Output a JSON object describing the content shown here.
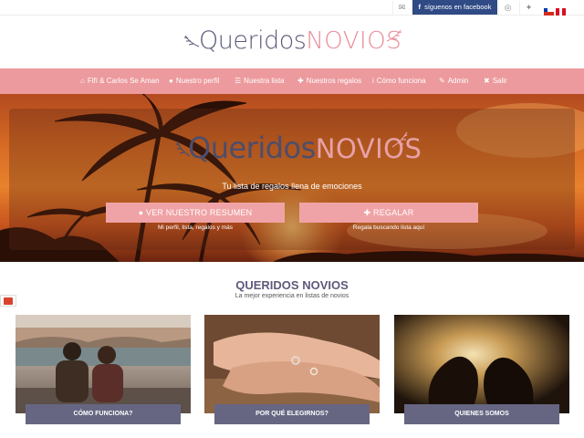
{
  "topbar": {
    "mail_icon": "envelope-icon",
    "facebook_label": "síguenos en facebook",
    "instagram_icon": "instagram-icon",
    "twitter_icon": "twitter-icon",
    "flags": [
      "chile-flag",
      "peru-flag"
    ]
  },
  "header": {
    "logo_part1": "Queridos",
    "logo_part2": "NOVIOS"
  },
  "nav": {
    "items": [
      {
        "icon": "home-icon",
        "glyph": "⌂",
        "label": "Fifí & Carlos Se Aman"
      },
      {
        "icon": "user-icon",
        "glyph": "●",
        "label": "Nuestro perfil"
      },
      {
        "icon": "list-icon",
        "glyph": "☰",
        "label": "Nuestra lista"
      },
      {
        "icon": "gift-icon",
        "glyph": "✚",
        "label": "Nuestros regalos"
      },
      {
        "icon": "info-icon",
        "glyph": "i",
        "label": "Cómo funciona"
      },
      {
        "icon": "wrench-icon",
        "glyph": "✎",
        "label": "Admin"
      },
      {
        "icon": "close-icon",
        "glyph": "✖",
        "label": "Salir"
      }
    ]
  },
  "hero": {
    "logo_part1": "Queridos",
    "logo_part2": "NOVIOS",
    "tagline": "Tu lista de regalos llena de emociones",
    "btn_left": "VER NUESTRO RESUMEN",
    "btn_left_sub": "Mi perfil, lista, regalos y más",
    "btn_right": "REGALAR",
    "btn_right_sub": "Regala buscando lista aquí"
  },
  "section": {
    "title": "QUERIDOS NOVIOS",
    "subtitle": "La mejor experiencia en listas de novios"
  },
  "cards": [
    {
      "label": "CÓMO FUNCIONA?"
    },
    {
      "label": "POR QUÉ ELEGIRNOS?"
    },
    {
      "label": "QUIENES SOMOS"
    }
  ],
  "colors": {
    "accent_pink": "#ec9a9d",
    "facebook_blue": "#2f4a84",
    "label_purple": "#666683",
    "title_purple": "#5e5a7c"
  }
}
